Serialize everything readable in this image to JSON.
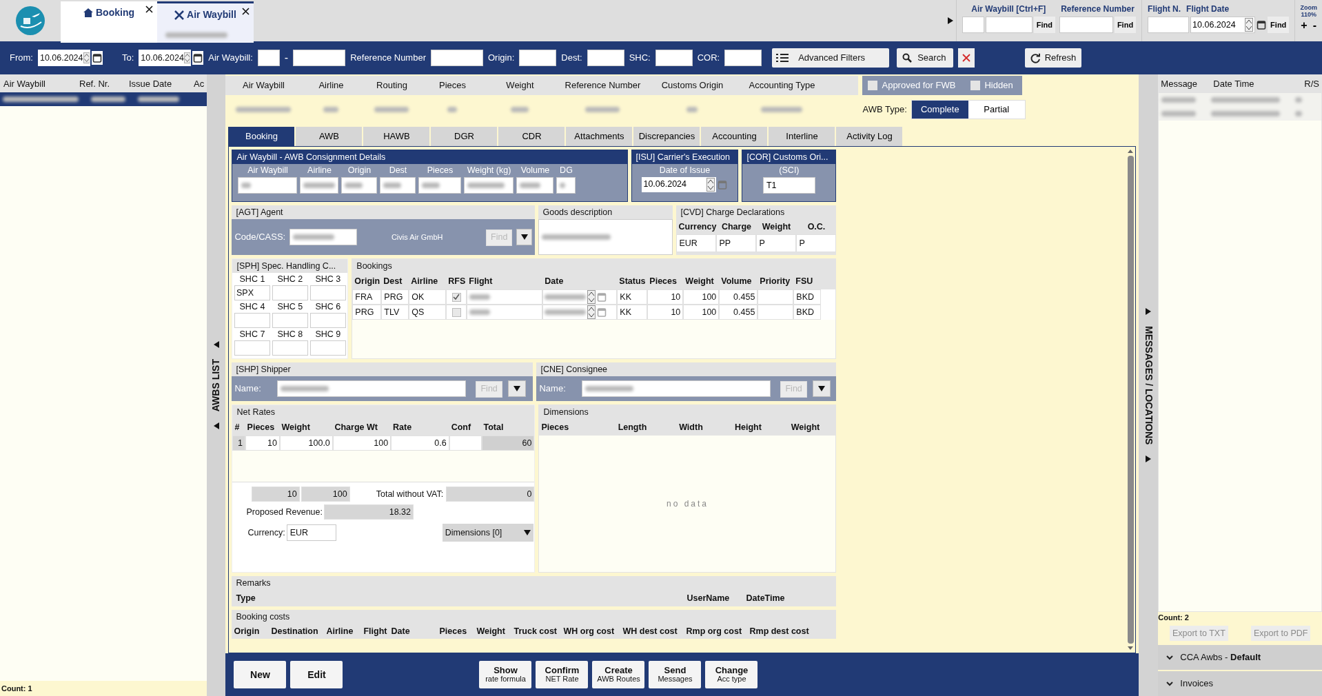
{
  "app_tabs": [
    {
      "label": "Booking",
      "selected": false,
      "blurred_subtitle": false
    },
    {
      "label": "Air Waybill",
      "selected": true,
      "blurred_subtitle": true
    }
  ],
  "quick_find": {
    "awb_label": "Air Waybill [Ctrl+F]",
    "ref_label": "Reference Number",
    "flight_label": "Flight N.",
    "date_label": "Flight Date",
    "date_value": "10.06.2024",
    "find_buttons": [
      "Find",
      "Find",
      "Find"
    ],
    "zoom_label": "Zoom",
    "zoom_value": "110%",
    "zoom_in": "+",
    "zoom_out": "-"
  },
  "filter_bar": {
    "from_label": "From:",
    "from_value": "10.06.2024",
    "to_label": "To:",
    "to_value": "10.06.2024",
    "awb_label": "Air Waybill:",
    "dash": "-",
    "ref_label": "Reference Number",
    "origin_label": "Origin:",
    "dest_label": "Dest:",
    "shc_label": "SHC:",
    "cor_label": "COR:",
    "advanced": "Advanced Filters",
    "search": "Search",
    "refresh": "Refresh"
  },
  "awb_list": {
    "columns": [
      "Air Waybill",
      "Ref. Nr.",
      "Issue Date",
      "Ac"
    ],
    "rows": [
      {
        "selected": true
      }
    ],
    "count": "Count: 1",
    "side_label": "AWBS LIST"
  },
  "summary": {
    "columns": [
      "Air Waybill",
      "Airline",
      "Routing",
      "Pieces",
      "Weight",
      "Reference Number",
      "Customs Origin",
      "Accounting Type"
    ],
    "checks": [
      {
        "label": "Approved for FWB",
        "checked": false
      },
      {
        "label": "Hidden",
        "checked": false
      }
    ],
    "awb_type_label": "AWB Type:",
    "awb_types": [
      {
        "label": "Complete",
        "selected": true
      },
      {
        "label": "Partial",
        "selected": false
      }
    ]
  },
  "tabs": [
    {
      "label": "Booking",
      "selected": true
    },
    {
      "label": "AWB",
      "selected": false
    },
    {
      "label": "HAWB",
      "selected": false
    },
    {
      "label": "DGR",
      "selected": false
    },
    {
      "label": "CDR",
      "selected": false
    },
    {
      "label": "Attachments",
      "selected": false
    },
    {
      "label": "Discrepancies",
      "selected": false
    },
    {
      "label": "Accounting",
      "selected": false
    },
    {
      "label": "Interline",
      "selected": false
    },
    {
      "label": "Activity Log",
      "selected": false
    }
  ],
  "consignment": {
    "title": "Air Waybill - AWB Consignment Details",
    "columns": [
      "Air Waybill",
      "Airline",
      "Origin",
      "Dest",
      "Pieces",
      "Weight (kg)",
      "Volume",
      "DG"
    ]
  },
  "isu": {
    "title": "[ISU] Carrier's Execution",
    "label": "Date of Issue",
    "value": "10.06.2024"
  },
  "cor": {
    "title": "[COR] Customs Ori...",
    "label": "(SCI)",
    "value": "T1"
  },
  "agent": {
    "title": "[AGT] Agent",
    "code_label": "Code/CASS:",
    "name": "Civis Air GmbH",
    "find": "Find"
  },
  "goods": {
    "title": "Goods description"
  },
  "cvd": {
    "title": "[CVD] Charge Declarations",
    "columns": [
      "Currency",
      "Charge",
      "Weight",
      "O.C."
    ],
    "values": [
      "EUR",
      "PP",
      "P",
      "P"
    ]
  },
  "sph": {
    "title": "[SPH] Spec. Handling C...",
    "shc": [
      {
        "label": "SHC 1",
        "value": "SPX"
      },
      {
        "label": "SHC 2"
      },
      {
        "label": "SHC 3"
      },
      {
        "label": "SHC 4"
      },
      {
        "label": "SHC 5"
      },
      {
        "label": "SHC 6"
      },
      {
        "label": "SHC 7"
      },
      {
        "label": "SHC 8"
      },
      {
        "label": "SHC 9"
      }
    ]
  },
  "bookings": {
    "title": "Bookings",
    "columns": [
      "Origin",
      "Dest",
      "Airline",
      "RFS",
      "Flight",
      "Date",
      "Status",
      "Pieces",
      "Weight",
      "Volume",
      "Priority",
      "FSU"
    ],
    "rows": [
      {
        "origin": "FRA",
        "dest": "PRG",
        "airline": "OK",
        "rfs": true,
        "status": "KK",
        "pieces": "10",
        "weight": "100",
        "volume": "0.455",
        "fsu": "BKD"
      },
      {
        "origin": "PRG",
        "dest": "TLV",
        "airline": "QS",
        "rfs": false,
        "status": "KK",
        "pieces": "10",
        "weight": "100",
        "volume": "0.455",
        "fsu": "BKD"
      }
    ]
  },
  "shipper": {
    "title": "[SHP] Shipper",
    "name_label": "Name:",
    "find": "Find"
  },
  "consignee": {
    "title": "[CNE] Consignee",
    "name_label": "Name:",
    "find": "Find"
  },
  "net_rates": {
    "title": "Net Rates",
    "columns": [
      "#",
      "Pieces",
      "Weight",
      "Charge Wt",
      "Rate",
      "Conf",
      "Total"
    ],
    "rows": [
      {
        "num": "1",
        "pieces": "10",
        "weight": "100.0",
        "charge_wt": "100",
        "rate": "0.6",
        "total": "60"
      }
    ],
    "sum_pieces": "10",
    "sum_weight": "100",
    "vat_label": "Total without VAT:",
    "vat": "0",
    "revenue_label": "Proposed Revenue:",
    "revenue": "18.32",
    "currency_label": "Currency:",
    "currency": "EUR",
    "dimensions_button": "Dimensions [0]"
  },
  "dimensions": {
    "title": "Dimensions",
    "columns": [
      "Pieces",
      "Length",
      "Width",
      "Height",
      "Weight"
    ],
    "empty": "no data"
  },
  "remarks": {
    "title": "Remarks",
    "columns": [
      "Type",
      "UserName",
      "DateTime"
    ]
  },
  "booking_costs": {
    "title": "Booking costs",
    "columns": [
      "Origin",
      "Destination",
      "Airline",
      "Flight",
      "Date",
      "Pieces",
      "Weight",
      "Truck cost",
      "WH org cost",
      "WH dest cost",
      "Rmp org cost",
      "Rmp dest cost"
    ]
  },
  "actions_left": [
    {
      "title": "New"
    },
    {
      "title": "Edit"
    }
  ],
  "actions_center": [
    {
      "title": "Show",
      "subtitle": "rate formula"
    },
    {
      "title": "Confirm",
      "subtitle": "NET Rate"
    },
    {
      "title": "Create",
      "subtitle": "AWB Routes"
    },
    {
      "title": "Send",
      "subtitle": "Messages"
    },
    {
      "title": "Change",
      "subtitle": "Acc type"
    }
  ],
  "messages": {
    "side_label": "MESSAGES / LOCATIONS",
    "columns": [
      "Message",
      "Date Time",
      "R/S"
    ],
    "rows": [
      {
        "blurred": true
      },
      {
        "blurred": true
      }
    ],
    "count": "Count: 2",
    "exports": [
      {
        "label": "Export to TXT",
        "disabled": true
      },
      {
        "label": "Export to PDF",
        "disabled": true
      }
    ],
    "sections": [
      {
        "label": "CCA Awbs - **Default**"
      },
      {
        "label": "Invoices"
      }
    ]
  }
}
